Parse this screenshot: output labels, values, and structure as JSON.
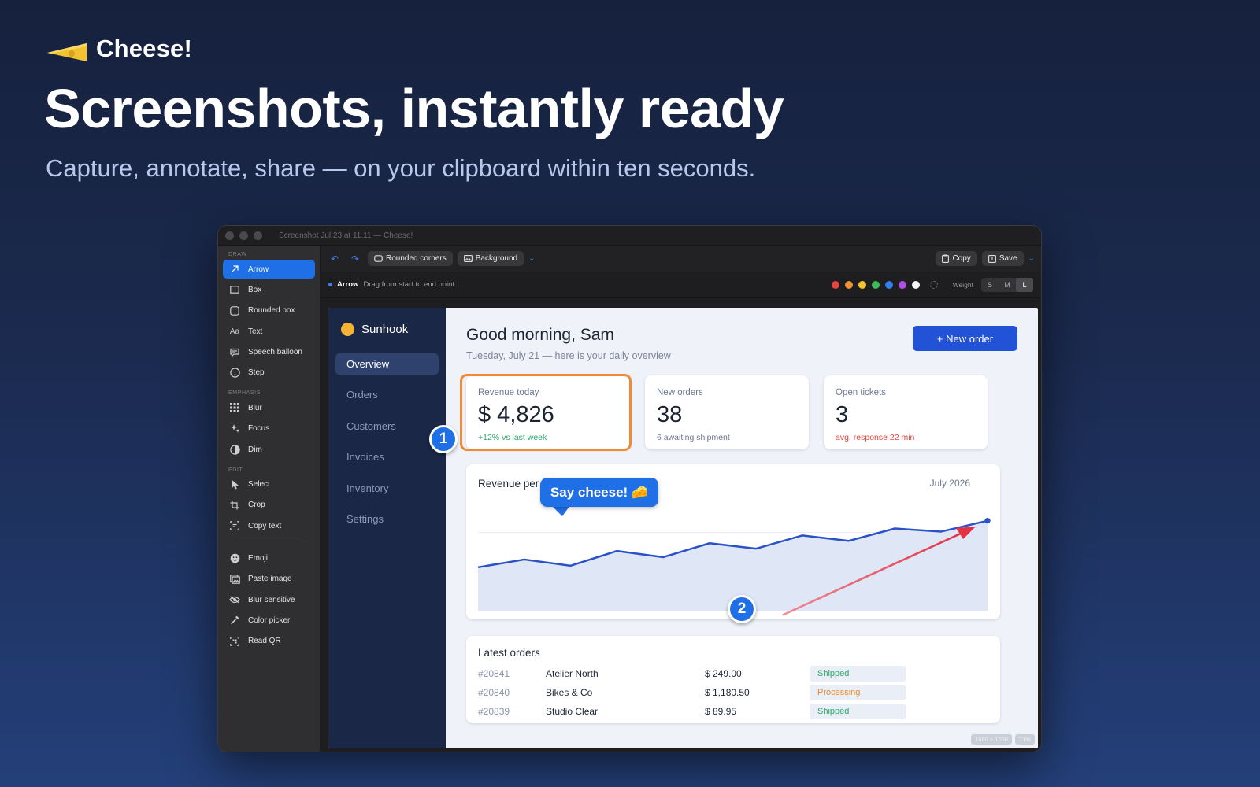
{
  "hero": {
    "brand_name": "Cheese!",
    "title": "Screenshots, instantly ready",
    "subtitle": "Capture, annotate, share — on your clipboard within ten seconds."
  },
  "window": {
    "title": "Screenshot Jul 23 at 11.11 — Cheese!"
  },
  "tools": {
    "draw_label": "DRAW",
    "draw": [
      {
        "label": "Arrow",
        "icon": "arrow-icon",
        "active": true
      },
      {
        "label": "Box",
        "icon": "box-icon"
      },
      {
        "label": "Rounded box",
        "icon": "rounded-box-icon"
      },
      {
        "label": "Text",
        "icon": "text-icon"
      },
      {
        "label": "Speech balloon",
        "icon": "speech-balloon-icon"
      },
      {
        "label": "Step",
        "icon": "step-icon"
      }
    ],
    "emphasis_label": "EMPHASIS",
    "emphasis": [
      {
        "label": "Blur",
        "icon": "blur-icon"
      },
      {
        "label": "Focus",
        "icon": "focus-icon"
      },
      {
        "label": "Dim",
        "icon": "dim-icon"
      }
    ],
    "edit_label": "EDIT",
    "edit": [
      {
        "label": "Select",
        "icon": "cursor-icon"
      },
      {
        "label": "Crop",
        "icon": "crop-icon"
      },
      {
        "label": "Copy text",
        "icon": "copy-text-icon"
      }
    ],
    "extras": [
      {
        "label": "Emoji",
        "icon": "emoji-icon"
      },
      {
        "label": "Paste image",
        "icon": "paste-image-icon"
      },
      {
        "label": "Blur sensitive",
        "icon": "eye-icon"
      },
      {
        "label": "Color picker",
        "icon": "eyedropper-icon"
      },
      {
        "label": "Read QR",
        "icon": "qr-icon"
      }
    ]
  },
  "toolbar": {
    "rounded_corners": "Rounded corners",
    "background": "Background",
    "copy": "Copy",
    "save": "Save"
  },
  "hint": {
    "tool": "Arrow",
    "text": "Drag from start to end point.",
    "colors": [
      "#e5453c",
      "#f0922f",
      "#f3c42b",
      "#3cba55",
      "#2f7ff0",
      "#b150e6",
      "#f5f5f5"
    ],
    "weight_label": "Weight",
    "weights": [
      "S",
      "M",
      "L"
    ],
    "weight_selected": "L"
  },
  "app": {
    "brand": "Sunhook",
    "nav": [
      "Overview",
      "Orders",
      "Customers",
      "Invoices",
      "Inventory",
      "Settings"
    ],
    "nav_active": "Overview",
    "greeting": "Good morning, Sam",
    "greeting_sub": "Tuesday, July 21 — here is your daily overview",
    "new_order": "+ New order",
    "kpis": [
      {
        "label": "Revenue today",
        "value": "$ 4,826",
        "note": "+12% vs last week",
        "note_color": "#2fa86a"
      },
      {
        "label": "New orders",
        "value": "38",
        "note": "6 awaiting shipment",
        "note_color": "#6d7790"
      },
      {
        "label": "Open tickets",
        "value": "3",
        "note": "avg. response 22 min",
        "note_color": "#e0453a"
      }
    ],
    "chart_title": "Revenue per day",
    "chart_period": "July 2026",
    "orders_title": "Latest orders",
    "orders": [
      {
        "id": "#20841",
        "customer": "Atelier North",
        "amount": "$ 249.00",
        "status": "Shipped",
        "status_color": "#2fa86a"
      },
      {
        "id": "#20840",
        "customer": "Bikes & Co",
        "amount": "$ 1,180.50",
        "status": "Processing",
        "status_color": "#ee8a2e"
      },
      {
        "id": "#20839",
        "customer": "Studio Clear",
        "amount": "$ 89.95",
        "status": "Shipped",
        "status_color": "#2fa86a"
      }
    ]
  },
  "annotations": {
    "step1": "1",
    "step2": "2",
    "balloon_text": "Say cheese! 🧀",
    "size_readout": "1680 × 1050",
    "zoom": "71%"
  },
  "chart_data": {
    "type": "area",
    "title": "Revenue per day",
    "series": [
      {
        "values": [
          56,
          66,
          58,
          77,
          69,
          87,
          80,
          97,
          90,
          106,
          102,
          116
        ]
      }
    ],
    "ylim": [
      0,
      140
    ],
    "grid": true,
    "colors": {
      "line": "#2a52c6",
      "fill": "#dfe7f7"
    }
  }
}
